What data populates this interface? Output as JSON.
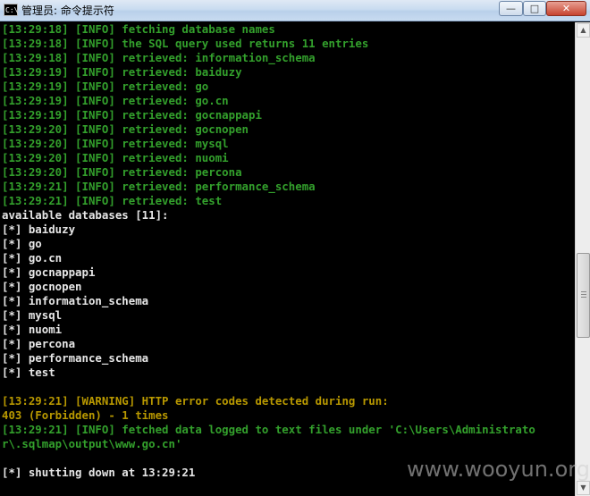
{
  "window": {
    "icon_text": "C:\\",
    "title": "管理员: 命令提示符",
    "buttons": {
      "minimize": "—",
      "maximize": "□",
      "close": "✕"
    }
  },
  "console": {
    "lines": [
      {
        "text": "[13:29:18] [INFO] fetching database names",
        "color": "green"
      },
      {
        "text": "[13:29:18] [INFO] the SQL query used returns 11 entries",
        "color": "green"
      },
      {
        "text": "[13:29:18] [INFO] retrieved: information_schema",
        "color": "green"
      },
      {
        "text": "[13:29:19] [INFO] retrieved: baiduzy",
        "color": "green"
      },
      {
        "text": "[13:29:19] [INFO] retrieved: go",
        "color": "green"
      },
      {
        "text": "[13:29:19] [INFO] retrieved: go.cn",
        "color": "green"
      },
      {
        "text": "[13:29:19] [INFO] retrieved: gocnappapi",
        "color": "green"
      },
      {
        "text": "[13:29:20] [INFO] retrieved: gocnopen",
        "color": "green"
      },
      {
        "text": "[13:29:20] [INFO] retrieved: mysql",
        "color": "green"
      },
      {
        "text": "[13:29:20] [INFO] retrieved: nuomi",
        "color": "green"
      },
      {
        "text": "[13:29:20] [INFO] retrieved: percona",
        "color": "green"
      },
      {
        "text": "[13:29:21] [INFO] retrieved: performance_schema",
        "color": "green"
      },
      {
        "text": "[13:29:21] [INFO] retrieved: test",
        "color": "green"
      },
      {
        "text": "available databases [11]:",
        "color": "white"
      },
      {
        "text": "[*] baiduzy",
        "color": "white"
      },
      {
        "text": "[*] go",
        "color": "white"
      },
      {
        "text": "[*] go.cn",
        "color": "white"
      },
      {
        "text": "[*] gocnappapi",
        "color": "white"
      },
      {
        "text": "[*] gocnopen",
        "color": "white"
      },
      {
        "text": "[*] information_schema",
        "color": "white"
      },
      {
        "text": "[*] mysql",
        "color": "white"
      },
      {
        "text": "[*] nuomi",
        "color": "white"
      },
      {
        "text": "[*] percona",
        "color": "white"
      },
      {
        "text": "[*] performance_schema",
        "color": "white"
      },
      {
        "text": "[*] test",
        "color": "white"
      },
      {
        "text": "",
        "color": "white"
      },
      {
        "text": "[13:29:21] [WARNING] HTTP error codes detected during run:",
        "color": "yellow"
      },
      {
        "text": "403 (Forbidden) - 1 times",
        "color": "yellow"
      },
      {
        "text": "[13:29:21] [INFO] fetched data logged to text files under 'C:\\Users\\Administrato",
        "color": "green"
      },
      {
        "text": "r\\.sqlmap\\output\\www.go.cn'",
        "color": "green"
      },
      {
        "text": "",
        "color": "white"
      },
      {
        "text": "[*] shutting down at 13:29:21",
        "color": "white"
      }
    ]
  },
  "scrollbar": {
    "up_arrow": "▲",
    "down_arrow": "▼"
  },
  "watermark": "www.wooyun.org",
  "colors": {
    "green": "#33a02c",
    "white": "#e6e6e6",
    "yellow": "#b89800",
    "background": "#000000"
  }
}
